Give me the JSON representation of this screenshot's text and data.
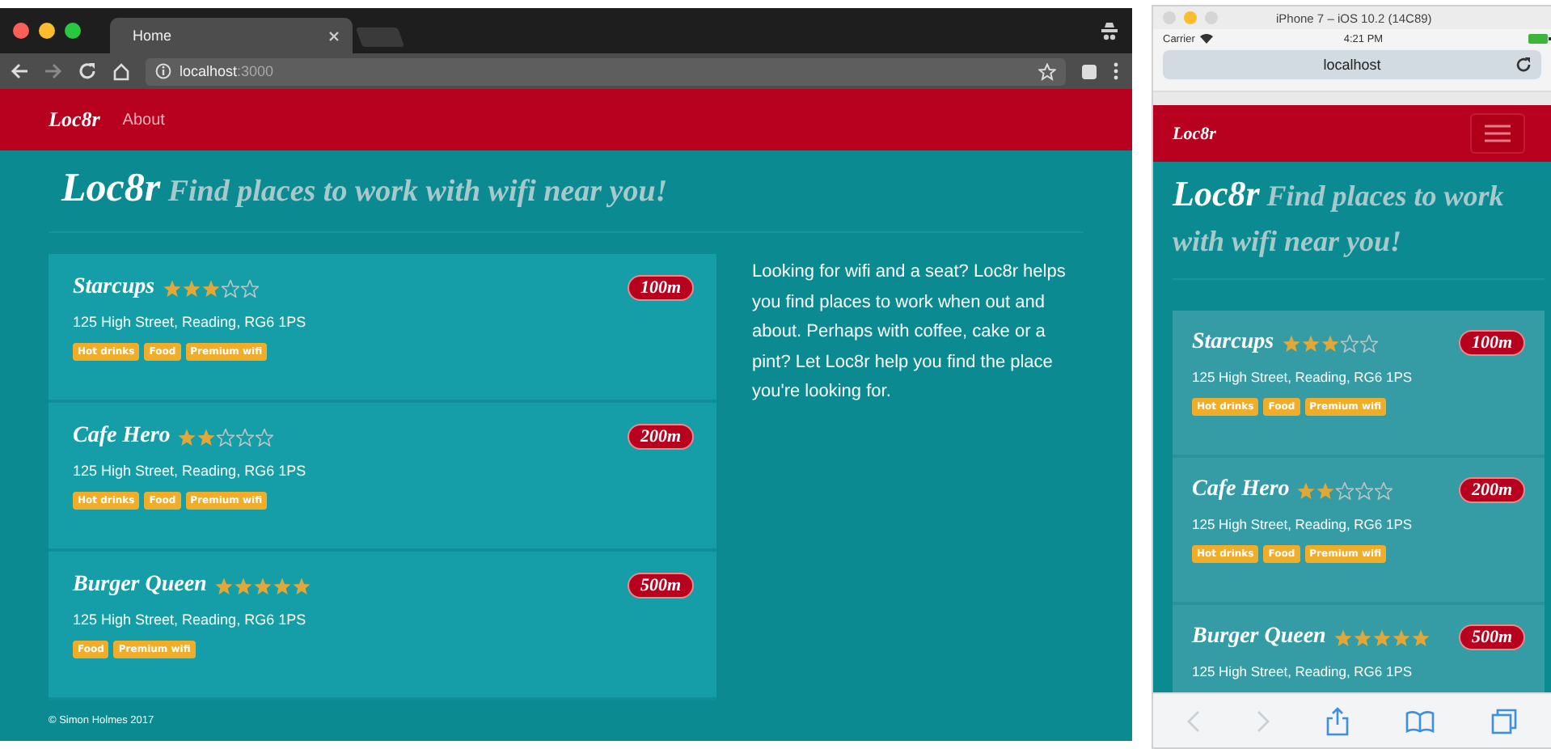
{
  "desktop": {
    "tab_title": "Home",
    "url_host": "localhost",
    "url_port": ":3000",
    "navbar": {
      "brand": "Loc8r",
      "links": [
        "About"
      ]
    },
    "heading": {
      "brand": "Loc8r",
      "tagline": "Find places to work with wifi near you!"
    },
    "locations": [
      {
        "name": "Starcups",
        "stars": 3,
        "address": "125 High Street, Reading, RG6 1PS",
        "facilities": [
          "Hot drinks",
          "Food",
          "Premium wifi"
        ],
        "distance": "100m"
      },
      {
        "name": "Cafe Hero",
        "stars": 2,
        "address": "125 High Street, Reading, RG6 1PS",
        "facilities": [
          "Hot drinks",
          "Food",
          "Premium wifi"
        ],
        "distance": "200m"
      },
      {
        "name": "Burger Queen",
        "stars": 5,
        "address": "125 High Street, Reading, RG6 1PS",
        "facilities": [
          "Food",
          "Premium wifi"
        ],
        "distance": "500m"
      }
    ],
    "sidebar_text": "Looking for wifi and a seat? Loc8r helps you find places to work when out and about. Perhaps with coffee, cake or a pint? Let Loc8r help you find the place you're looking for.",
    "footer": "© Simon Holmes 2017"
  },
  "phone": {
    "window_title": "iPhone 7 – iOS 10.2 (14C89)",
    "carrier": "Carrier",
    "time": "4:21 PM",
    "url": "localhost",
    "navbar": {
      "brand": "Loc8r"
    },
    "heading": {
      "brand": "Loc8r",
      "tagline": "Find places to work with wifi near you!"
    },
    "locations": [
      {
        "name": "Starcups",
        "stars": 3,
        "address": "125 High Street, Reading, RG6 1PS",
        "facilities": [
          "Hot drinks",
          "Food",
          "Premium wifi"
        ],
        "distance": "100m"
      },
      {
        "name": "Cafe Hero",
        "stars": 2,
        "address": "125 High Street, Reading, RG6 1PS",
        "facilities": [
          "Hot drinks",
          "Food",
          "Premium wifi"
        ],
        "distance": "200m"
      },
      {
        "name": "Burger Queen",
        "stars": 5,
        "address": "125 High Street, Reading, RG6 1PS",
        "distance": "500m"
      }
    ]
  }
}
